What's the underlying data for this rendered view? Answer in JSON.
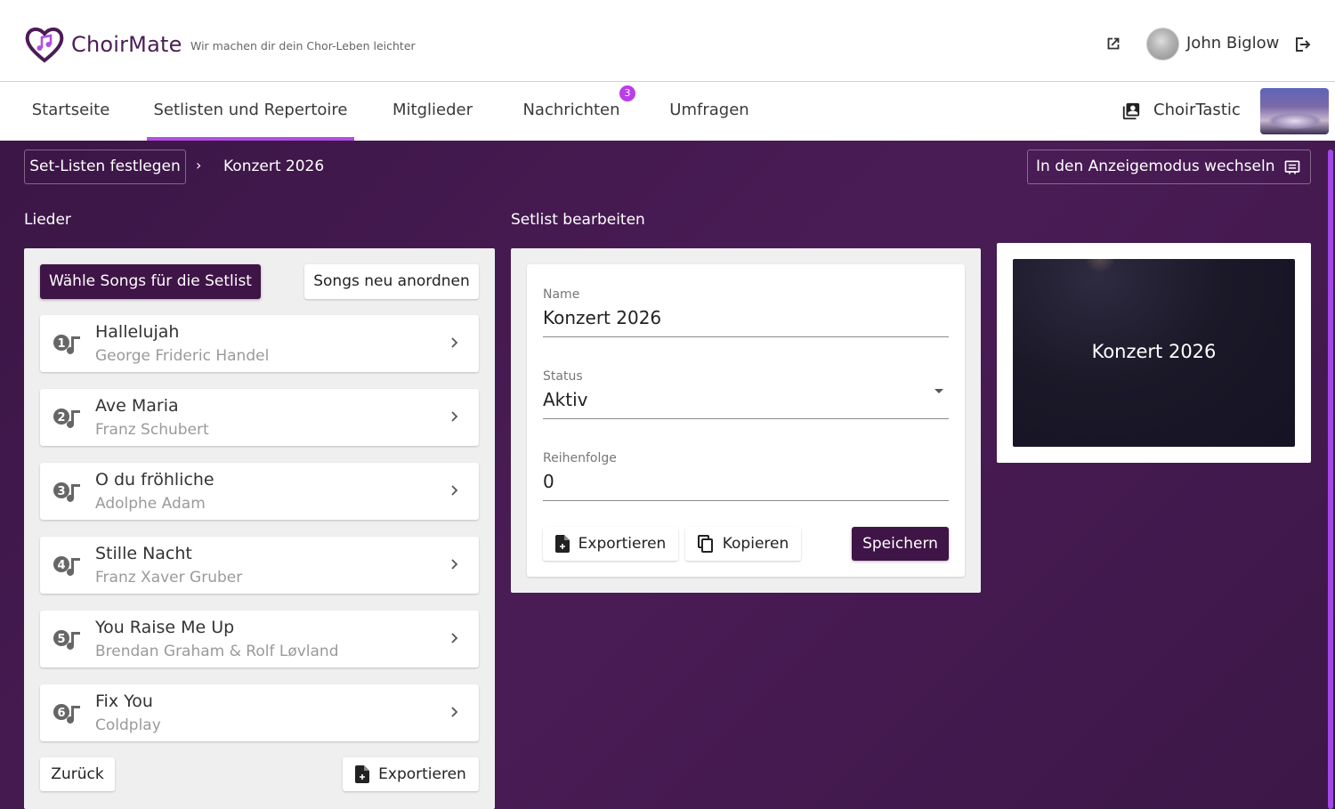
{
  "app": {
    "brand": "ChoirMate",
    "tagline": "Wir machen dir dein Chor-Leben leichter",
    "user_name": "John Biglow",
    "accent_color": "#b34de0",
    "primary_color": "#3f1446"
  },
  "nav": {
    "tabs": [
      {
        "label": "Startseite"
      },
      {
        "label": "Setlisten und Repertoire",
        "active": true
      },
      {
        "label": "Mitglieder"
      },
      {
        "label": "Nachrichten",
        "badge": "3"
      },
      {
        "label": "Umfragen"
      }
    ],
    "choir_name": "ChoirTastic"
  },
  "breadcrumb": {
    "parent": "Set-Listen festlegen",
    "separator": "›",
    "current": "Konzert 2026"
  },
  "view_mode_button": "In den Anzeigemodus wechseln",
  "songs_section": {
    "title": "Lieder",
    "select_button": "Wähle Songs für die Setlist",
    "reorder_button": "Songs neu anordnen",
    "songs": [
      {
        "number": "1",
        "title": "Hallelujah",
        "artist": "George Frideric Handel"
      },
      {
        "number": "2",
        "title": "Ave Maria",
        "artist": "Franz Schubert"
      },
      {
        "number": "3",
        "title": "O du fröhliche",
        "artist": "Adolphe Adam"
      },
      {
        "number": "4",
        "title": "Stille Nacht",
        "artist": "Franz Xaver Gruber"
      },
      {
        "number": "5",
        "title": "You Raise Me Up",
        "artist": "Brendan Graham & Rolf Løvland"
      },
      {
        "number": "6",
        "title": "Fix You",
        "artist": "Coldplay"
      }
    ],
    "back_button": "Zurück",
    "export_button": "Exportieren"
  },
  "edit_section": {
    "title": "Setlist bearbeiten",
    "name_label": "Name",
    "name_value": "Konzert 2026",
    "status_label": "Status",
    "status_value": "Aktiv",
    "order_label": "Reihenfolge",
    "order_value": "0",
    "export_button": "Exportieren",
    "copy_button": "Kopieren",
    "save_button": "Speichern"
  },
  "preview": {
    "title": "Konzert 2026"
  }
}
